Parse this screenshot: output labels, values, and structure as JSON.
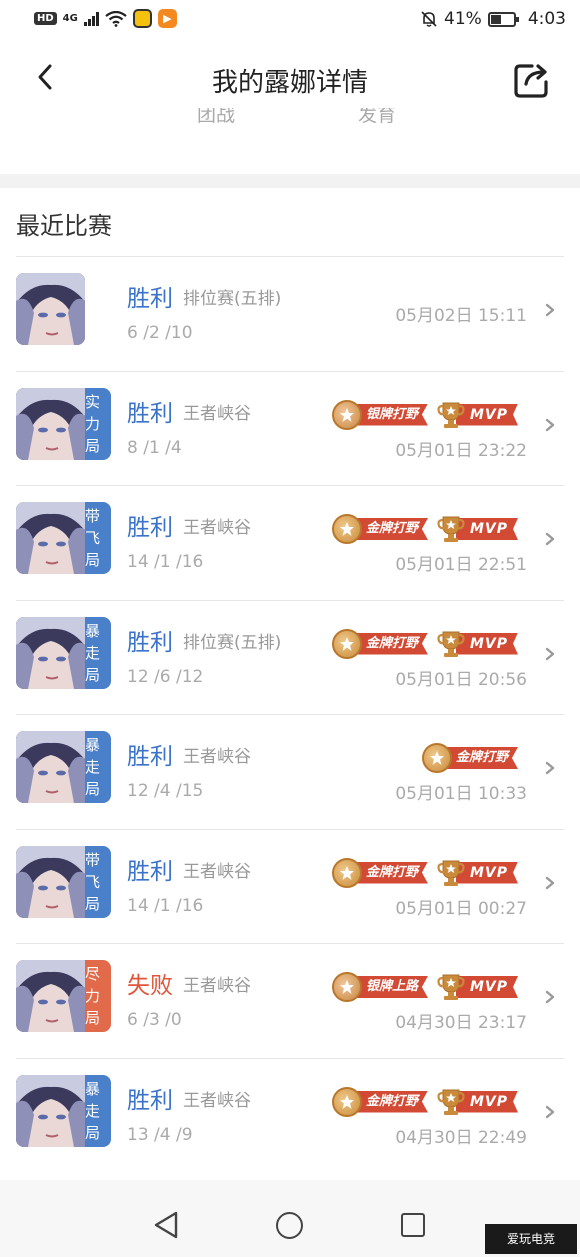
{
  "status_bar": {
    "left_icons": [
      "hd-icon",
      "4g-signal-icon",
      "wifi-icon",
      "app-icon",
      "video-app-icon"
    ],
    "battery_percent": "41%",
    "time": "4:03"
  },
  "header": {
    "title": "我的露娜详情"
  },
  "cut_tabs": [
    "团战",
    "发育"
  ],
  "section_title": "最近比赛",
  "matches": [
    {
      "result": "胜利",
      "win": true,
      "mode": "排位赛(五排)",
      "kda": "6 /2 /10",
      "time": "05月02日 15:11",
      "tag": "",
      "badges": []
    },
    {
      "result": "胜利",
      "win": true,
      "mode": "王者峡谷",
      "kda": "8 /1 /4",
      "time": "05月01日 23:22",
      "tag": "实力局",
      "badges": [
        "银牌打野",
        "MVP"
      ]
    },
    {
      "result": "胜利",
      "win": true,
      "mode": "王者峡谷",
      "kda": "14 /1 /16",
      "time": "05月01日 22:51",
      "tag": "带飞局",
      "badges": [
        "金牌打野",
        "MVP"
      ]
    },
    {
      "result": "胜利",
      "win": true,
      "mode": "排位赛(五排)",
      "kda": "12 /6 /12",
      "time": "05月01日 20:56",
      "tag": "暴走局",
      "badges": [
        "金牌打野",
        "MVP"
      ]
    },
    {
      "result": "胜利",
      "win": true,
      "mode": "王者峡谷",
      "kda": "12 /4 /15",
      "time": "05月01日 10:33",
      "tag": "暴走局",
      "badges": [
        "金牌打野"
      ]
    },
    {
      "result": "胜利",
      "win": true,
      "mode": "王者峡谷",
      "kda": "14 /1 /16",
      "time": "05月01日 00:27",
      "tag": "带飞局",
      "badges": [
        "金牌打野",
        "MVP"
      ]
    },
    {
      "result": "失败",
      "win": false,
      "mode": "王者峡谷",
      "kda": "6 /3 /0",
      "time": "04月30日 23:17",
      "tag": "尽力局",
      "badges": [
        "银牌上路",
        "MVP"
      ]
    },
    {
      "result": "胜利",
      "win": true,
      "mode": "王者峡谷",
      "kda": "13 /4 /9",
      "time": "04月30日 22:49",
      "tag": "暴走局",
      "badges": [
        "金牌打野",
        "MVP"
      ]
    }
  ],
  "watermark": "爱玩电竞",
  "colors": {
    "win": "#3a73c9",
    "lose": "#e0553a",
    "tag_blue": "#4a7fc9",
    "tag_red": "#e06a4a",
    "badge_ribbon": "#d24a34"
  }
}
